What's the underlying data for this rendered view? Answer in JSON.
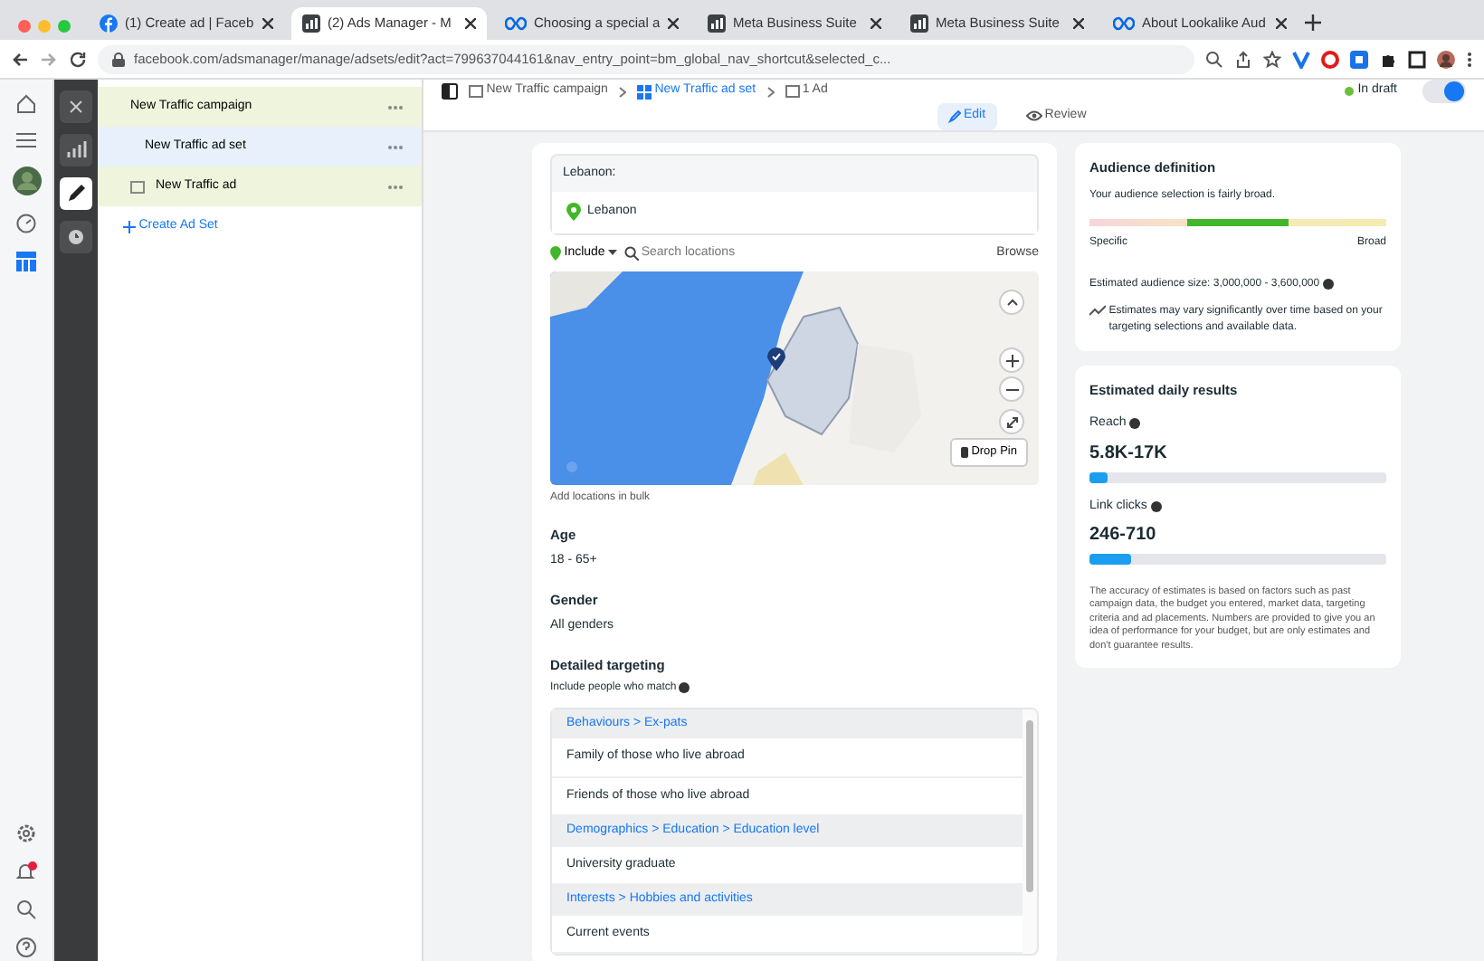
{
  "browser": {
    "tabs": [
      {
        "label": "(1) Create ad | Faceb",
        "kind": "fb",
        "selected": false
      },
      {
        "label": "(2) Ads Manager - M",
        "kind": "ads",
        "selected": true
      },
      {
        "label": "Choosing a special a",
        "kind": "meta",
        "selected": false
      },
      {
        "label": "Meta Business Suite",
        "kind": "ads",
        "selected": false
      },
      {
        "label": "Meta Business Suite",
        "kind": "ads",
        "selected": false
      },
      {
        "label": "About Lookalike Aud",
        "kind": "meta",
        "selected": false
      }
    ],
    "url": "facebook.com/adsmanager/manage/adsets/edit?act=799637044161&nav_entry_point=bm_global_nav_shortcut&selected_c..."
  },
  "tree": {
    "items": [
      {
        "label": "New Traffic campaign",
        "kind": "campaign",
        "selected": false
      },
      {
        "label": "New Traffic ad set",
        "kind": "adset",
        "selected": true
      },
      {
        "label": "New Traffic ad",
        "kind": "ad",
        "selected": false
      }
    ],
    "create": "Create Ad Set"
  },
  "header": {
    "breadcrumbs": [
      {
        "label": "New Traffic campaign",
        "selected": false
      },
      {
        "label": "New Traffic ad set",
        "selected": true
      },
      {
        "label": "1 Ad",
        "selected": false
      }
    ],
    "status": "In draft",
    "toggle_on": true,
    "modes": [
      {
        "label": "Edit",
        "selected": true
      },
      {
        "label": "Review",
        "selected": false
      }
    ]
  },
  "locations": {
    "heading": "Lebanon:",
    "items": [
      "Lebanon"
    ],
    "include": "Include",
    "search_placeholder": "Search locations",
    "browse": "Browse",
    "drop_pin": "Drop Pin",
    "add_link": "Add locations in bulk"
  },
  "age": {
    "label": "Age",
    "value": "18 - 65+"
  },
  "gender": {
    "label": "Gender",
    "value": "All genders"
  },
  "targeting": {
    "label": "Detailed targeting",
    "hint": "Include people who match",
    "groups": [
      {
        "path": "Behaviours > Ex-pats",
        "items": [
          "Family of those who live abroad",
          "Friends of those who live abroad"
        ]
      },
      {
        "path": "Demographics > Education > Education level",
        "items": [
          "University graduate"
        ]
      },
      {
        "path": "Interests > Hobbies and activities",
        "items": [
          "Current events"
        ]
      }
    ]
  },
  "audience": {
    "title": "Audience definition",
    "desc": "Your audience selection is fairly broad.",
    "level": 0.5,
    "low": "Specific",
    "high": "Broad",
    "size": "Estimated audience size: 3,000,000 - 3,600,000",
    "note": "Estimates may vary significantly over time based on your targeting selections and available data."
  },
  "daily": {
    "title": "Estimated daily results",
    "metrics": [
      {
        "label": "Reach",
        "value": "5.8K-17K",
        "level": 0.06
      },
      {
        "label": "Link clicks",
        "value": "246-710",
        "level": 0.14
      }
    ],
    "disclaimer": "The accuracy of estimates is based on factors such as past campaign data, the budget you entered, market data, targeting criteria and ad placements. Numbers are provided to give you an idea of performance for your budget, but are only estimates and don't guarantee results."
  }
}
